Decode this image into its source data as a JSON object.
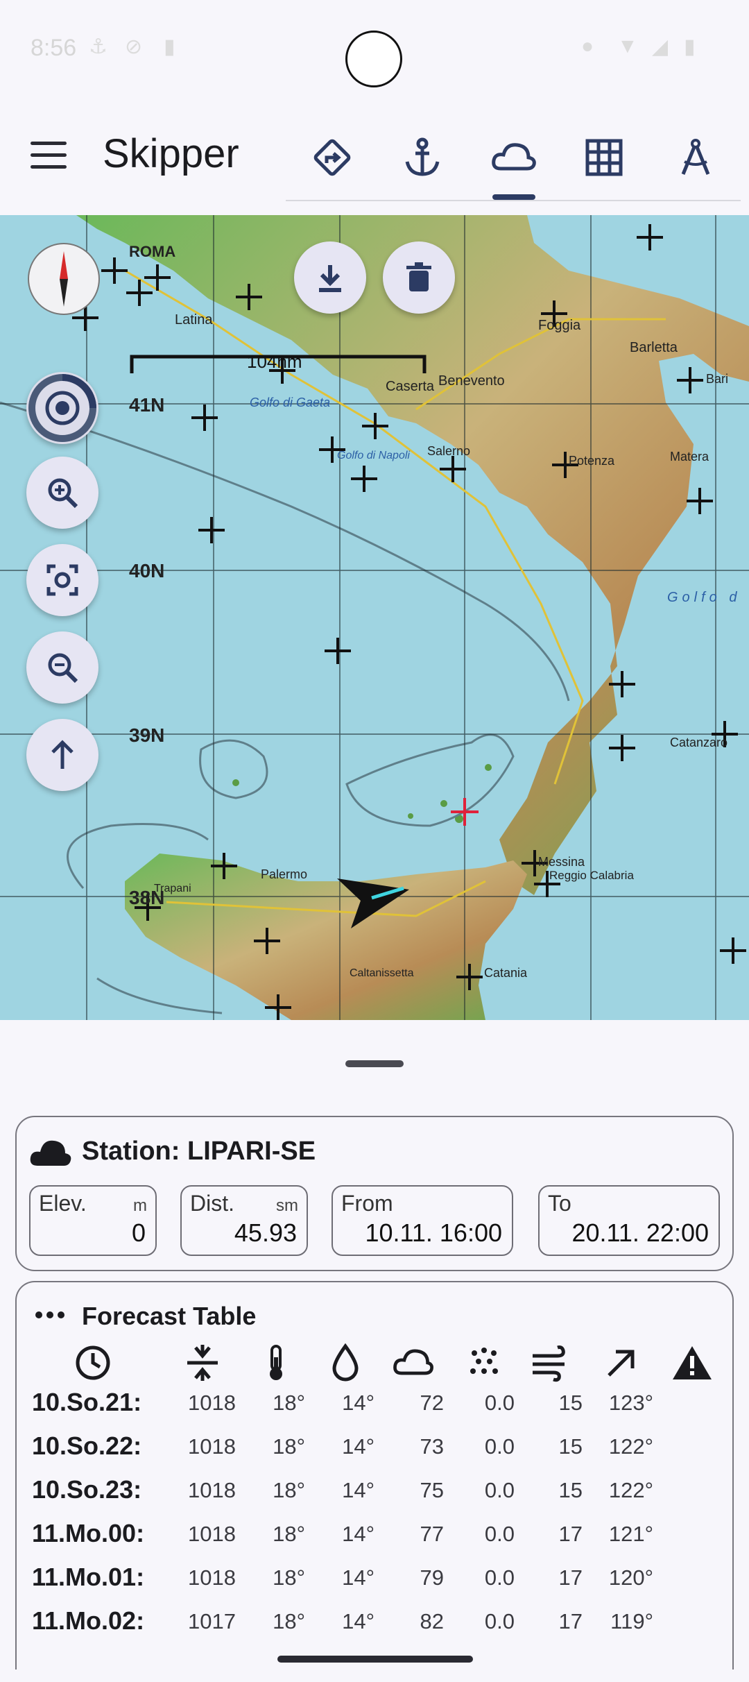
{
  "status_bar": {
    "time": "8:56"
  },
  "app": {
    "title": "Skipper"
  },
  "tabs": [
    {
      "name": "route",
      "icon": "route-diamond-icon"
    },
    {
      "name": "anchor",
      "icon": "anchor-icon"
    },
    {
      "name": "weather",
      "icon": "cloud-icon",
      "selected": true
    },
    {
      "name": "grid",
      "icon": "grid-icon"
    },
    {
      "name": "compass-tool",
      "icon": "divider-compass-icon"
    }
  ],
  "map": {
    "scale_label": "104nm",
    "lat_labels": [
      "41N",
      "40N",
      "39N",
      "38N"
    ],
    "place_labels": {
      "roma": "ROMA",
      "latina": "Latina",
      "caserta": "Caserta",
      "benevento": "Benevento",
      "golfo_gaeta": "Golfo di Gaeta",
      "golfo_napoli": "Golfo di Napoli",
      "salerno": "Salerno",
      "potenza": "Potenza",
      "bari": "Bari",
      "barletta": "Barletta",
      "foggia": "Foggia",
      "matera": "Matera",
      "catanzaro": "Catanzaro",
      "messina": "Messina",
      "reggio": "Reggio Calabria",
      "palermo": "Palermo",
      "catania": "Catania",
      "trapani": "Trapani",
      "caltanissetta": "Caltanissetta",
      "golfo": "Golfo d"
    }
  },
  "station": {
    "title": "Station: LIPARI-SE",
    "elev_label": "Elev.",
    "elev_unit": "m",
    "elev_value": "0",
    "dist_label": "Dist.",
    "dist_unit": "sm",
    "dist_value": "45.93",
    "from_label": "From",
    "from_value": "10.11. 16:00",
    "to_label": "To",
    "to_value": "20.11. 22:00"
  },
  "forecast": {
    "title": "Forecast Table",
    "rows": [
      {
        "date": "10.So.21:",
        "pressure": "1018",
        "temp": "18°",
        "dew": "14°",
        "cloud": "72",
        "precip": "0.0",
        "wind": "15",
        "dir": "123°"
      },
      {
        "date": "10.So.22:",
        "pressure": "1018",
        "temp": "18°",
        "dew": "14°",
        "cloud": "73",
        "precip": "0.0",
        "wind": "15",
        "dir": "122°"
      },
      {
        "date": "10.So.23:",
        "pressure": "1018",
        "temp": "18°",
        "dew": "14°",
        "cloud": "75",
        "precip": "0.0",
        "wind": "15",
        "dir": "122°"
      },
      {
        "date": "11.Mo.00:",
        "pressure": "1018",
        "temp": "18°",
        "dew": "14°",
        "cloud": "77",
        "precip": "0.0",
        "wind": "17",
        "dir": "121°"
      },
      {
        "date": "11.Mo.01:",
        "pressure": "1018",
        "temp": "18°",
        "dew": "14°",
        "cloud": "79",
        "precip": "0.0",
        "wind": "17",
        "dir": "120°"
      },
      {
        "date": "11.Mo.02:",
        "pressure": "1017",
        "temp": "18°",
        "dew": "14°",
        "cloud": "82",
        "precip": "0.0",
        "wind": "17",
        "dir": "119°"
      }
    ]
  }
}
